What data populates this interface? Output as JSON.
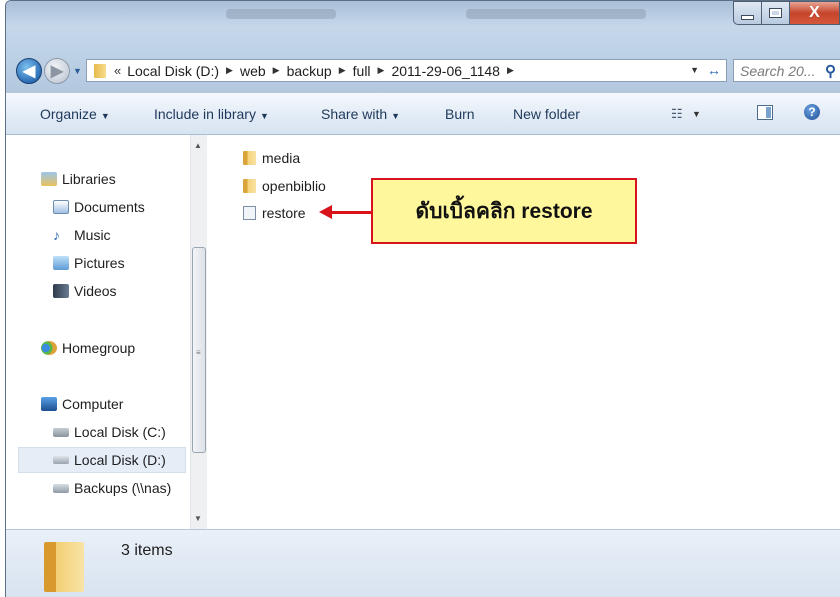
{
  "window": {
    "controls": {
      "minimize": "",
      "maximize": "",
      "close": "X"
    }
  },
  "nav": {
    "back_glyph": "◀",
    "forward_glyph": "▶",
    "address": {
      "overflow": "«",
      "crumbs": [
        "Local Disk (D:)",
        "web",
        "backup",
        "full",
        "2011-29-06_1148"
      ]
    },
    "search_placeholder": "Search 20..."
  },
  "toolbar": {
    "organize": "Organize",
    "include_in_library": "Include in library",
    "share_with": "Share with",
    "burn": "Burn",
    "new_folder": "New folder",
    "help": "?"
  },
  "sidebar": {
    "libraries": "Libraries",
    "documents": "Documents",
    "music": "Music",
    "pictures": "Pictures",
    "videos": "Videos",
    "homegroup": "Homegroup",
    "computer": "Computer",
    "local_c": "Local Disk (C:)",
    "local_d": "Local Disk (D:)",
    "backups": "Backups (\\\\nas)"
  },
  "files": [
    {
      "name": "media",
      "icon": "folder-icon"
    },
    {
      "name": "openbiblio",
      "icon": "folder-icon"
    },
    {
      "name": "restore",
      "icon": "script-file-icon"
    }
  ],
  "annotation": {
    "text": "ดับเบิ้ลคลิก restore",
    "border_color": "#d8131b",
    "fill_color": "#fef79b"
  },
  "details": {
    "item_count": "3 items"
  }
}
